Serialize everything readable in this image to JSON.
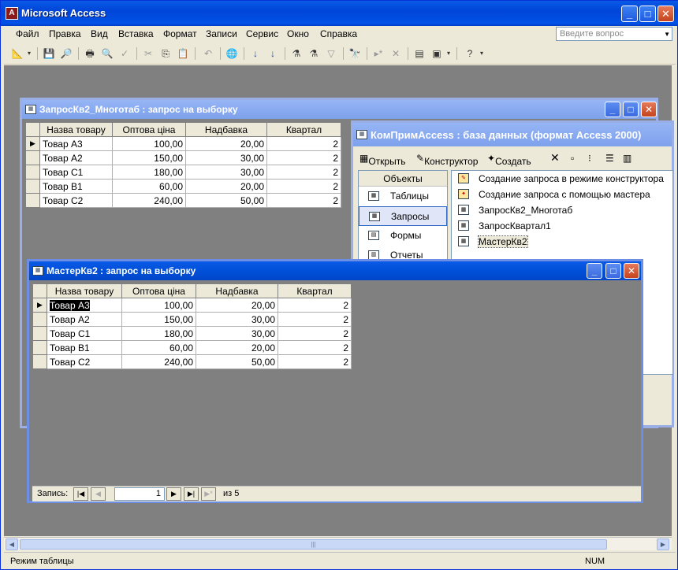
{
  "app": {
    "title": "Microsoft Access"
  },
  "menu": [
    "Файл",
    "Правка",
    "Вид",
    "Вставка",
    "Формат",
    "Записи",
    "Сервис",
    "Окно",
    "Справка"
  ],
  "ask_placeholder": "Введите вопрос",
  "status": {
    "left": "Режим таблицы",
    "right": "NUM"
  },
  "columns": [
    "Назва товару",
    "Оптова ціна",
    "Надбавка",
    "Квартал"
  ],
  "rows": [
    [
      "Товар А3",
      "100,00",
      "20,00",
      "2"
    ],
    [
      "Товар А2",
      "150,00",
      "30,00",
      "2"
    ],
    [
      "Товар С1",
      "180,00",
      "30,00",
      "2"
    ],
    [
      "Товар В1",
      "60,00",
      "20,00",
      "2"
    ],
    [
      "Товар С2",
      "240,00",
      "50,00",
      "2"
    ]
  ],
  "win1": {
    "title": "ЗапросКв2_Многотаб : запрос на выборку"
  },
  "win2": {
    "title": "МастерКв2 : запрос на выборку",
    "nav": {
      "label": "Запись:",
      "current": "1",
      "of": "из 5"
    }
  },
  "db": {
    "title": "КомПримAccess : база данных (формат Access 2000)",
    "toolbar": {
      "open": "Открыть",
      "design": "Конструктор",
      "create": "Создать"
    },
    "objects_header": "Объекты",
    "objects": [
      "Таблицы",
      "Запросы",
      "Формы",
      "Отчеты"
    ],
    "items": [
      "Создание запроса в режиме конструктора",
      "Создание запроса с помощью мастера",
      "ЗапросКв2_Многотаб",
      "ЗапросКвартал1",
      "МастерКв2"
    ]
  }
}
